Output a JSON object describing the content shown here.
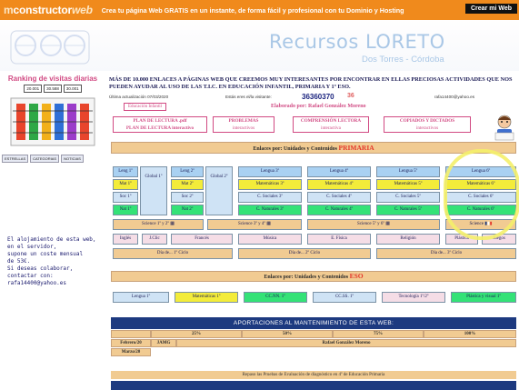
{
  "topbar": {
    "brand_m": "m",
    "brand_main": "constructor",
    "brand_web": "web",
    "promo": "Crea tu página Web GRATIS en un instante, de forma fácil y profesional con tu Dominio y Hosting",
    "cta": "Crear mi Web"
  },
  "header": {
    "title": "Recursos LORETO",
    "subtitle": "Dos Torres - Córdoba"
  },
  "sidebar": {
    "rank_title": "Ranking de visitas diarias",
    "rank_buttons": [
      "20.001",
      "30.588",
      "30.001"
    ],
    "small_buttons": [
      "ESTRELLAS",
      "CATEGORIAS",
      "NOTICIAS"
    ],
    "note": [
      "El alojamiento de esta web,",
      "en el servidor,",
      "supone un coste mensual",
      "de 53€.",
      "Si deseas colaborar,",
      "contactar con:",
      "rafa14400@yahoo.es"
    ]
  },
  "main": {
    "intro": "MÁS DE 10.000 ENLACES A PÁGINAS WEB QUE CREEMOS MUY INTERESANTES POR ENCONTRAR EN ELLAS PRECIOSAS ACTIVIDADES QUE NOS PUEDEN AYUDAR AL USO DE LAS T.I.C. EN EDUCACIÓN INFANTIL, PRIMARIA Y 1º ESO.",
    "updated": "Última actualización 07/03/2020",
    "visitors_label": "Estás eres el/la visitante:",
    "counter": "36360370",
    "counter_small": "36",
    "email": "rafa14400@yahoo.es",
    "ed_link": "Educación Infantil",
    "elaborado": "Elaborado por: Rafael González Moreno",
    "nav": [
      {
        "t1": "PLAN DE LECTURA .pdf",
        "t2": "PLAN DE LECTURA interactivo"
      },
      {
        "t1": "PROBLEMAS",
        "t2": "interactivos"
      },
      {
        "t1": "COMPRENSIÓN LECTORA",
        "t2": "interactiva"
      },
      {
        "t1": "COPIADOS Y DICTADOS",
        "t2": "interactivos"
      }
    ],
    "primaria_bar_pre": "Enlaces por: Unidades y Contenidos",
    "primaria_bar_hl": "PRIMARIA",
    "grid": {
      "global1": "Global 1º",
      "global2": "Global 2º",
      "col1": [
        "Leng 1º",
        "Mat 1º",
        "Soc 1º",
        "Nat 1º"
      ],
      "col2": [
        "Leng 2º",
        "Mat 2º",
        "Soc 2º",
        "Nat 2º"
      ],
      "col3": [
        "Lengua 3º",
        "Matemáticas 3º",
        "C. Sociales 3º",
        "C. Naturales 3º"
      ],
      "col4": [
        "Lengua 4º",
        "Matemáticas 4º",
        "C. Sociales 4º",
        "C. Naturales 4º"
      ],
      "col5": [
        "Lengua 5º",
        "Matemáticas 5º",
        "C. Sociales 5º",
        "C. Naturales 5º"
      ],
      "col6": [
        "Lengua 6º",
        "Matemáticas 6º",
        "C. Sociales 6º",
        "C. Naturales 6º"
      ]
    },
    "science": [
      "Science 1º y 2º",
      "Science 3º y 4º",
      "Science 5º y 6º",
      "Science"
    ],
    "subjects": [
      "Inglés",
      "J.Clic",
      "Francés",
      "Música",
      "E. Física",
      "Religión",
      "Plástica",
      "Juegos"
    ],
    "dias": [
      "Día de... 1º Ciclo",
      "Día de... 2º Ciclo",
      "Día de... 3º Ciclo"
    ],
    "eso_bar_pre": "Enlaces por: Unidades y Contenidos",
    "eso_bar_hl": "ESO",
    "eso": [
      "Lengua 1º",
      "Matemáticas 1º",
      "CC.NN. 1º",
      "CC.SS. 1º",
      "Tecnología 1º/2º",
      "Plástica y visual 1º"
    ],
    "aport": "APORTACIONES AL MANTENIMIENTO DE ESTA WEB:",
    "pcts": [
      "25%",
      "50%",
      "75%",
      "100%"
    ],
    "aport_rows": [
      {
        "label": "Febrero/20",
        "who": "JAMG",
        "name": "Rafael González Moreno"
      },
      {
        "label": "Marzo/20",
        "who": "",
        "name": ""
      }
    ],
    "pruebas": "Repaso las Pruebas de Evaluación de diagnóstico en 4º de Educación Primaria"
  },
  "colors": {
    "orange": "#f08a1c",
    "navy": "#1d3a80",
    "tan": "#f1cb92",
    "blue": "#a9d1f2",
    "yellow": "#f3ec3a",
    "green": "#34e277",
    "pink": "#d14a83"
  }
}
